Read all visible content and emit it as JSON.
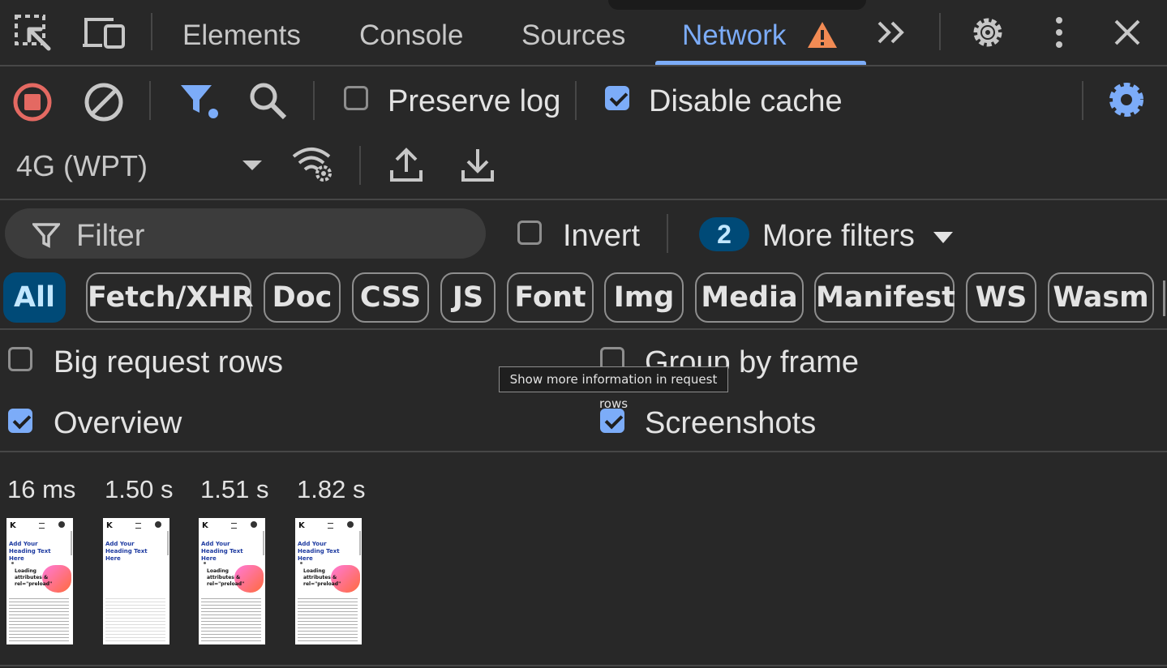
{
  "tabs": {
    "elements": "Elements",
    "console": "Console",
    "sources": "Sources",
    "network": "Network"
  },
  "toolbar": {
    "preserve_log": "Preserve log",
    "preserve_log_checked": false,
    "disable_cache": "Disable cache",
    "disable_cache_checked": true,
    "throttling": "4G (WPT)"
  },
  "filter_bar": {
    "filter_placeholder": "Filter",
    "invert": "Invert",
    "invert_checked": false,
    "more_filters_count": "2",
    "more_filters": "More filters"
  },
  "type_chips": [
    "All",
    "Fetch/XHR",
    "Doc",
    "CSS",
    "JS",
    "Font",
    "Img",
    "Media",
    "Manifest",
    "WS",
    "Wasm"
  ],
  "settings": {
    "big_request_rows": "Big request rows",
    "big_request_rows_checked": false,
    "group_by_frame": "Group by frame",
    "group_by_frame_checked": false,
    "overview": "Overview",
    "overview_checked": true,
    "screenshots": "Screenshots",
    "screenshots_checked": true
  },
  "tooltip": "Show more information in request rows",
  "screenshots": {
    "times": [
      "16 ms",
      "1.50 s",
      "1.51 s",
      "1.82 s"
    ],
    "thumb_logo": "K",
    "thumb_heading": "Add Your Heading Text Here",
    "thumb_card_title": "Loading attributes & rel=\"preload\""
  },
  "colors": {
    "accent": "#7cacf8",
    "warning": "#f28b54",
    "record_red": "#e46962",
    "panel_bg": "#282828"
  },
  "icons": [
    "inspect-icon",
    "device-toggle-icon",
    "warning-icon",
    "more-tabs-icon",
    "gear-icon",
    "kebab-menu-icon",
    "close-icon",
    "record-stop-icon",
    "clear-icon",
    "filter-funnel-icon",
    "search-icon",
    "network-conditions-icon",
    "import-har-icon",
    "export-har-icon",
    "settings-gear-icon",
    "chevron-down-icon"
  ]
}
